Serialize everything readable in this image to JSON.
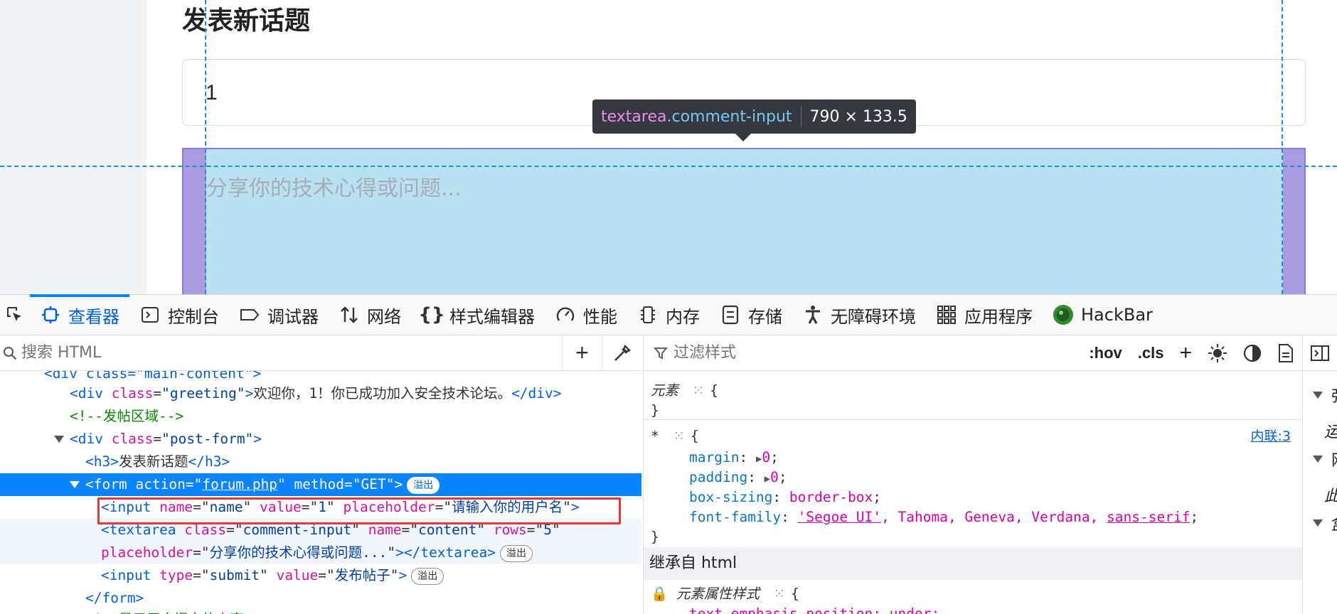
{
  "page": {
    "heading": "发表新话题",
    "name_input_value": "1",
    "textarea_placeholder": "分享你的技术心得或问题..."
  },
  "tooltip": {
    "tag": "textarea",
    "class": ".comment-input",
    "size": "790 × 133.5"
  },
  "devtools": {
    "tabs": [
      {
        "label": "查看器",
        "icon": "inspector-icon",
        "active": true
      },
      {
        "label": "控制台",
        "icon": "console-icon"
      },
      {
        "label": "调试器",
        "icon": "debugger-icon"
      },
      {
        "label": "网络",
        "icon": "network-icon"
      },
      {
        "label": "样式编辑器",
        "icon": "style-editor-icon"
      },
      {
        "label": "性能",
        "icon": "performance-icon"
      },
      {
        "label": "内存",
        "icon": "memory-icon"
      },
      {
        "label": "存储",
        "icon": "storage-icon"
      },
      {
        "label": "无障碍环境",
        "icon": "accessibility-icon"
      },
      {
        "label": "应用程序",
        "icon": "application-icon"
      },
      {
        "label": "HackBar",
        "icon": "hackbar-icon"
      }
    ],
    "markup_search_placeholder": "搜索 HTML",
    "rules_filter_placeholder": "过滤样式",
    "rules_buttons": {
      "hov": ":hov",
      "cls": ".cls"
    },
    "markup_lines": {
      "l0": "<div class=\"main-content\">",
      "greeting_text": "欢迎你，1！你已成功加入安全技术论坛。",
      "comment": "<!--发帖区域-->",
      "h3_text": "发表新话题",
      "form_action": "forum.php",
      "form_method": "GET",
      "input_name": "name",
      "input_value": "1",
      "input_placeholder": "请输入你的用户名",
      "textarea_class": "comment-input",
      "textarea_name": "content",
      "textarea_rows": "5",
      "textarea_placeholder": "分享你的技术心得或问题...",
      "submit_type": "submit",
      "submit_value": "发布帖子",
      "last_comment": "<!--显示用户提交的内容-->",
      "overflow_badge": "溢出"
    },
    "rules": {
      "element_label": "元素",
      "universal_selector": "*",
      "source": "内联:3",
      "declarations": [
        {
          "prop": "margin",
          "value": "0"
        },
        {
          "prop": "padding",
          "value": "0"
        },
        {
          "prop": "box-sizing",
          "value": "border-box"
        }
      ],
      "font_family_prop": "font-family",
      "font_family_values": [
        "'Segoe UI'",
        "Tahoma",
        "Geneva",
        "Verdana",
        "sans-serif"
      ],
      "inherited_from": "继承自 html",
      "attr_style_label": "元素属性样式",
      "last_line": "text-emphasis-position: under;"
    },
    "side_labels": [
      "强",
      "运",
      "网",
      "此",
      "盒"
    ]
  }
}
